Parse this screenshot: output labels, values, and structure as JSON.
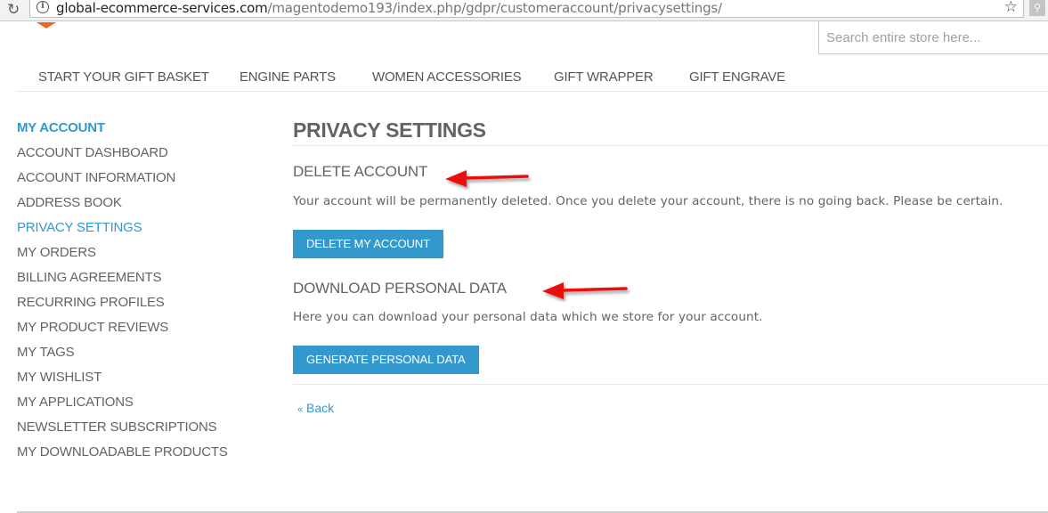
{
  "browser": {
    "url_host": "global-ecommerce-services.com",
    "url_path": "/magentodemo193/index.php/gdpr/customeraccount/privacysettings/",
    "icons": {
      "reload": "reload-icon",
      "info": "info-icon",
      "bookmark": "star-icon",
      "extension": "search-extension-icon"
    }
  },
  "header": {
    "search_placeholder": "Search entire store here..."
  },
  "nav": {
    "items": [
      {
        "label": "START YOUR GIFT BASKET"
      },
      {
        "label": "ENGINE PARTS"
      },
      {
        "label": "WOMEN ACCESSORIES"
      },
      {
        "label": "GIFT WRAPPER"
      },
      {
        "label": "GIFT ENGRAVE"
      }
    ]
  },
  "sidebar": {
    "title": "MY ACCOUNT",
    "items": [
      {
        "label": "ACCOUNT DASHBOARD",
        "active": false
      },
      {
        "label": "ACCOUNT INFORMATION",
        "active": false
      },
      {
        "label": "ADDRESS BOOK",
        "active": false
      },
      {
        "label": "PRIVACY SETTINGS",
        "active": true
      },
      {
        "label": "MY ORDERS",
        "active": false
      },
      {
        "label": "BILLING AGREEMENTS",
        "active": false
      },
      {
        "label": "RECURRING PROFILES",
        "active": false
      },
      {
        "label": "MY PRODUCT REVIEWS",
        "active": false
      },
      {
        "label": "MY TAGS",
        "active": false
      },
      {
        "label": "MY WISHLIST",
        "active": false
      },
      {
        "label": "MY APPLICATIONS",
        "active": false
      },
      {
        "label": "NEWSLETTER SUBSCRIPTIONS",
        "active": false
      },
      {
        "label": "MY DOWNLOADABLE PRODUCTS",
        "active": false
      }
    ],
    "accent_color": "#3399cc"
  },
  "main": {
    "title": "PRIVACY SETTINGS",
    "delete_section": {
      "title": "DELETE ACCOUNT",
      "description": "Your account will be permanently deleted. Once you delete your account, there is no going back. Please be certain.",
      "button_label": "DELETE MY ACCOUNT"
    },
    "download_section": {
      "title": "DOWNLOAD PERSONAL DATA",
      "description": "Here you can download your personal data which we store for your account.",
      "button_label": "GENERATE PERSONAL DATA"
    },
    "back_arrow": "«",
    "back_label": "Back",
    "button_color": "#3399cc"
  },
  "annotations": {
    "arrow_color": "#ee1111",
    "arrows": [
      "annotation-arrow-delete-account",
      "annotation-arrow-download-data"
    ]
  }
}
